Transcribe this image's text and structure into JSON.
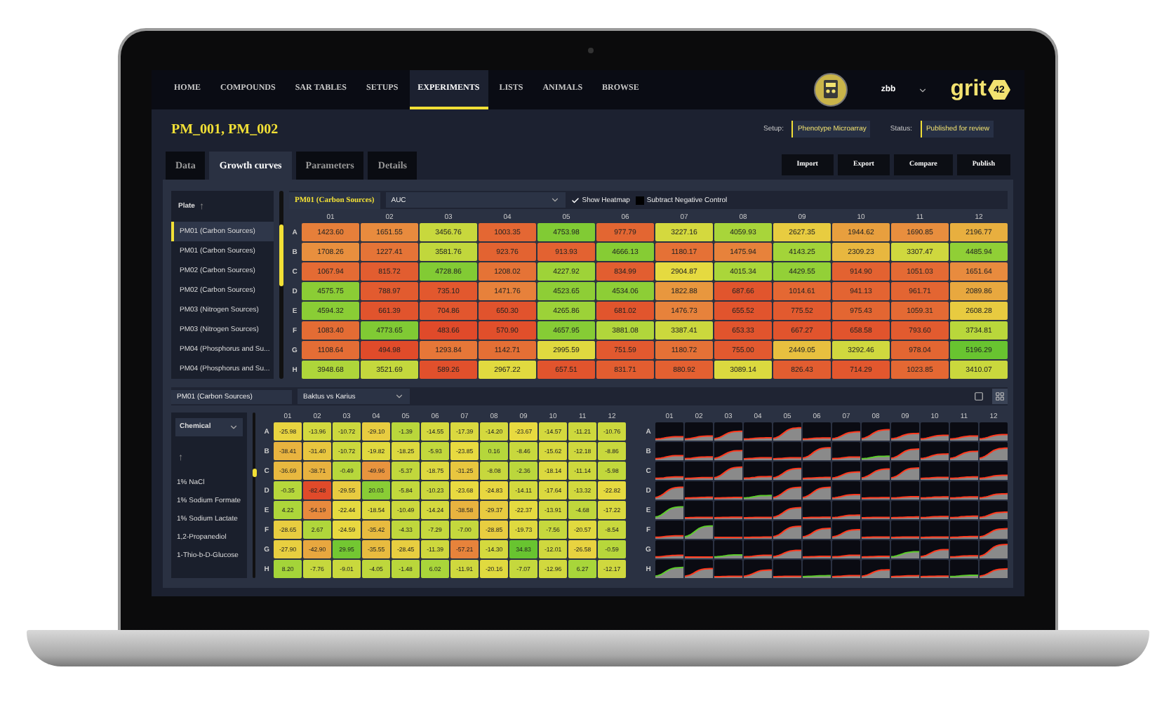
{
  "nav": {
    "items": [
      {
        "label": "HOME",
        "selected": false
      },
      {
        "label": "COMPOUNDS",
        "selected": false
      },
      {
        "label": "SAR TABLES",
        "selected": false
      },
      {
        "label": "SETUPS",
        "selected": false
      },
      {
        "label": "EXPERIMENTS",
        "selected": true
      },
      {
        "label": "LISTS",
        "selected": false
      },
      {
        "label": "ANIMALS",
        "selected": false
      },
      {
        "label": "BROWSE",
        "selected": false
      }
    ],
    "user": "zbb",
    "logo": {
      "text": "grit",
      "badge": "42"
    }
  },
  "experiment": {
    "title": "PM_001, PM_002",
    "setup_label": "Setup:",
    "setup": "Phenotype Microarray",
    "status_label": "Status:",
    "status": "Published for review"
  },
  "tabs": [
    {
      "label": "Data",
      "selected": false
    },
    {
      "label": "Growth curves",
      "selected": true
    },
    {
      "label": "Parameters",
      "selected": false
    },
    {
      "label": "Details",
      "selected": false
    }
  ],
  "actions": [
    "Import",
    "Export",
    "Compare",
    "Publish"
  ],
  "plates": {
    "header": "Plate",
    "sort": "↑",
    "items": [
      {
        "label": "PM01 (Carbon Sources)",
        "selected": true
      },
      {
        "label": "PM01 (Carbon Sources)",
        "selected": false
      },
      {
        "label": "PM02 (Carbon Sources)",
        "selected": false
      },
      {
        "label": "PM02 (Carbon Sources)",
        "selected": false
      },
      {
        "label": "PM03 (Nitrogen Sources)",
        "selected": false
      },
      {
        "label": "PM03 (Nitrogen Sources)",
        "selected": false
      },
      {
        "label": "PM04 (Phosphorus and Su...",
        "selected": false
      },
      {
        "label": "PM04 (Phosphorus and Su...",
        "selected": false
      }
    ]
  },
  "toolbar": {
    "plate": "PM01 (Carbon Sources)",
    "metric": "AUC",
    "show_heatmap": {
      "label": "Show Heatmap",
      "checked": true
    },
    "subtract": {
      "label": "Subtract Negative Control",
      "checked": false
    }
  },
  "heatmap": {
    "columns": [
      "01",
      "02",
      "03",
      "04",
      "05",
      "06",
      "07",
      "08",
      "09",
      "10",
      "11",
      "12"
    ],
    "rows": [
      {
        "label": "A",
        "values": [
          "1423.60",
          "1651.55",
          "3456.76",
          "1003.35",
          "4753.98",
          "977.79",
          "3227.16",
          "4059.93",
          "2627.35",
          "1944.62",
          "1690.85",
          "2196.77"
        ]
      },
      {
        "label": "B",
        "values": [
          "1708.26",
          "1227.41",
          "3581.76",
          "923.76",
          "913.93",
          "4666.13",
          "1180.17",
          "1475.94",
          "4143.25",
          "2309.23",
          "3307.47",
          "4485.94"
        ]
      },
      {
        "label": "C",
        "values": [
          "1067.94",
          "815.72",
          "4728.86",
          "1208.02",
          "4227.92",
          "834.99",
          "2904.87",
          "4015.34",
          "4429.55",
          "914.90",
          "1051.03",
          "1651.64"
        ]
      },
      {
        "label": "D",
        "values": [
          "4575.75",
          "788.97",
          "735.10",
          "1471.76",
          "4523.65",
          "4534.06",
          "1822.88",
          "687.66",
          "1014.61",
          "941.13",
          "961.71",
          "2089.86"
        ]
      },
      {
        "label": "E",
        "values": [
          "4594.32",
          "661.39",
          "704.86",
          "650.30",
          "4265.86",
          "681.02",
          "1476.73",
          "655.52",
          "775.52",
          "975.43",
          "1059.31",
          "2608.28"
        ]
      },
      {
        "label": "F",
        "values": [
          "1083.40",
          "4773.65",
          "483.66",
          "570.90",
          "4657.95",
          "3881.08",
          "3387.41",
          "653.33",
          "667.27",
          "658.58",
          "793.60",
          "3734.81"
        ]
      },
      {
        "label": "G",
        "values": [
          "1108.64",
          "494.98",
          "1293.84",
          "1142.71",
          "2995.59",
          "751.59",
          "1180.72",
          "755.00",
          "2449.05",
          "3292.46",
          "978.04",
          "5196.29"
        ]
      },
      {
        "label": "H",
        "values": [
          "3948.68",
          "3521.69",
          "589.26",
          "2967.22",
          "657.51",
          "831.71",
          "880.92",
          "3089.14",
          "826.43",
          "714.29",
          "1023.85",
          "3410.07"
        ]
      }
    ]
  },
  "comparison": {
    "plate": "PM01 (Carbon Sources)",
    "pair": "Baktus vs Karius",
    "filter": "Chemical",
    "sort": "↑",
    "chemicals": [
      "1% NaCl",
      "1% Sodium Formate",
      "1% Sodium Lactate",
      "1,2-Propanediol",
      "1-Thio-b-D-Glucose"
    ],
    "view": [
      {
        "kind": "single",
        "selected": false
      },
      {
        "kind": "grid",
        "selected": true
      }
    ],
    "heatmap": {
      "columns": [
        "01",
        "02",
        "03",
        "04",
        "05",
        "06",
        "07",
        "08",
        "09",
        "10",
        "11",
        "12"
      ],
      "rows": [
        {
          "label": "A",
          "values": [
            "-25.98",
            "-13.96",
            "-10.72",
            "-29.10",
            "-1.39",
            "-14.55",
            "-17.39",
            "-14.20",
            "-23.67",
            "-14.57",
            "-11.21",
            "-10.76"
          ]
        },
        {
          "label": "B",
          "values": [
            "-38.41",
            "-31.40",
            "-10.72",
            "-19.82",
            "-18.25",
            "-5.93",
            "-23.85",
            "0.16",
            "-8.46",
            "-15.62",
            "-12.18",
            "-8.86"
          ]
        },
        {
          "label": "C",
          "values": [
            "-36.69",
            "-38.71",
            "-0.49",
            "-49.96",
            "-5.37",
            "-18.75",
            "-31.25",
            "-8.08",
            "-2.36",
            "-18.14",
            "-11.14",
            "-5.98"
          ]
        },
        {
          "label": "D",
          "values": [
            "-0.35",
            "-82.48",
            "-29.55",
            "20.03",
            "-5.84",
            "-10.23",
            "-23.68",
            "-24.83",
            "-14.11",
            "-17.64",
            "-13.32",
            "-22.82"
          ]
        },
        {
          "label": "E",
          "values": [
            "4.22",
            "-54.19",
            "-22.44",
            "-18.54",
            "-10.49",
            "-14.24",
            "-38.58",
            "-29.37",
            "-22.37",
            "-13.91",
            "-4.68",
            "-17.22"
          ]
        },
        {
          "label": "F",
          "values": [
            "-28.65",
            "2.67",
            "-24.59",
            "-35.42",
            "-4.33",
            "-7.29",
            "-7.00",
            "-28.85",
            "-19.73",
            "-7.56",
            "-20.57",
            "-8.54"
          ]
        },
        {
          "label": "G",
          "values": [
            "-27.90",
            "-42.90",
            "29.95",
            "-35.55",
            "-28.45",
            "-11.39",
            "-57.21",
            "-14.30",
            "34.83",
            "-12.01",
            "-26.58",
            "-0.59"
          ]
        },
        {
          "label": "H",
          "values": [
            "8.20",
            "-7.76",
            "-9.01",
            "-4.05",
            "-1.48",
            "6.02",
            "-11.91",
            "-20.16",
            "-7.07",
            "-12.96",
            "6.27",
            "-12.17"
          ]
        }
      ]
    },
    "curves": {
      "columns": [
        "01",
        "02",
        "03",
        "04",
        "05",
        "06",
        "07",
        "08",
        "09",
        "10",
        "11",
        "12"
      ],
      "rows": [
        "A",
        "B",
        "C",
        "D",
        "E",
        "F",
        "G",
        "H"
      ]
    }
  }
}
